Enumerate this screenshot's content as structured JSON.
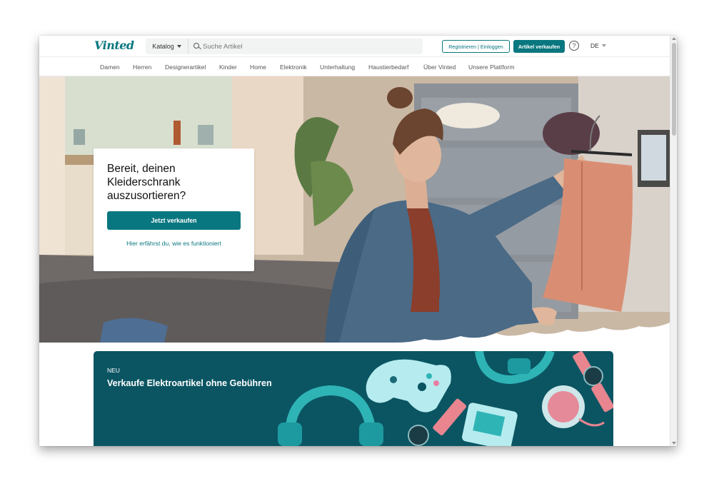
{
  "header": {
    "logo": "Vinted",
    "catalog_label": "Katalog",
    "search_placeholder": "Suche Artikel",
    "register_label": "Registrieren | Einloggen",
    "sell_label": "Artikel verkaufen",
    "help_icon": "?",
    "language": "DE"
  },
  "nav": {
    "items": [
      {
        "label": "Damen"
      },
      {
        "label": "Herren"
      },
      {
        "label": "Designerartikel"
      },
      {
        "label": "Kinder"
      },
      {
        "label": "Home"
      },
      {
        "label": "Elektronik"
      },
      {
        "label": "Unterhaltung"
      },
      {
        "label": "Haustierbedarf"
      },
      {
        "label": "Über Vinted"
      },
      {
        "label": "Unsere Plattform"
      }
    ]
  },
  "hero": {
    "title": "Bereit, deinen Kleiderschrank auszusortieren?",
    "cta_label": "Jetzt verkaufen",
    "link_label": "Hier erfährst du, wie es funktioniert"
  },
  "banner": {
    "tag": "NEU",
    "title": "Verkaufe Elektroartikel ohne Gebühren"
  },
  "colors": {
    "brand": "#09777f",
    "banner_bg": "#0b5563"
  }
}
